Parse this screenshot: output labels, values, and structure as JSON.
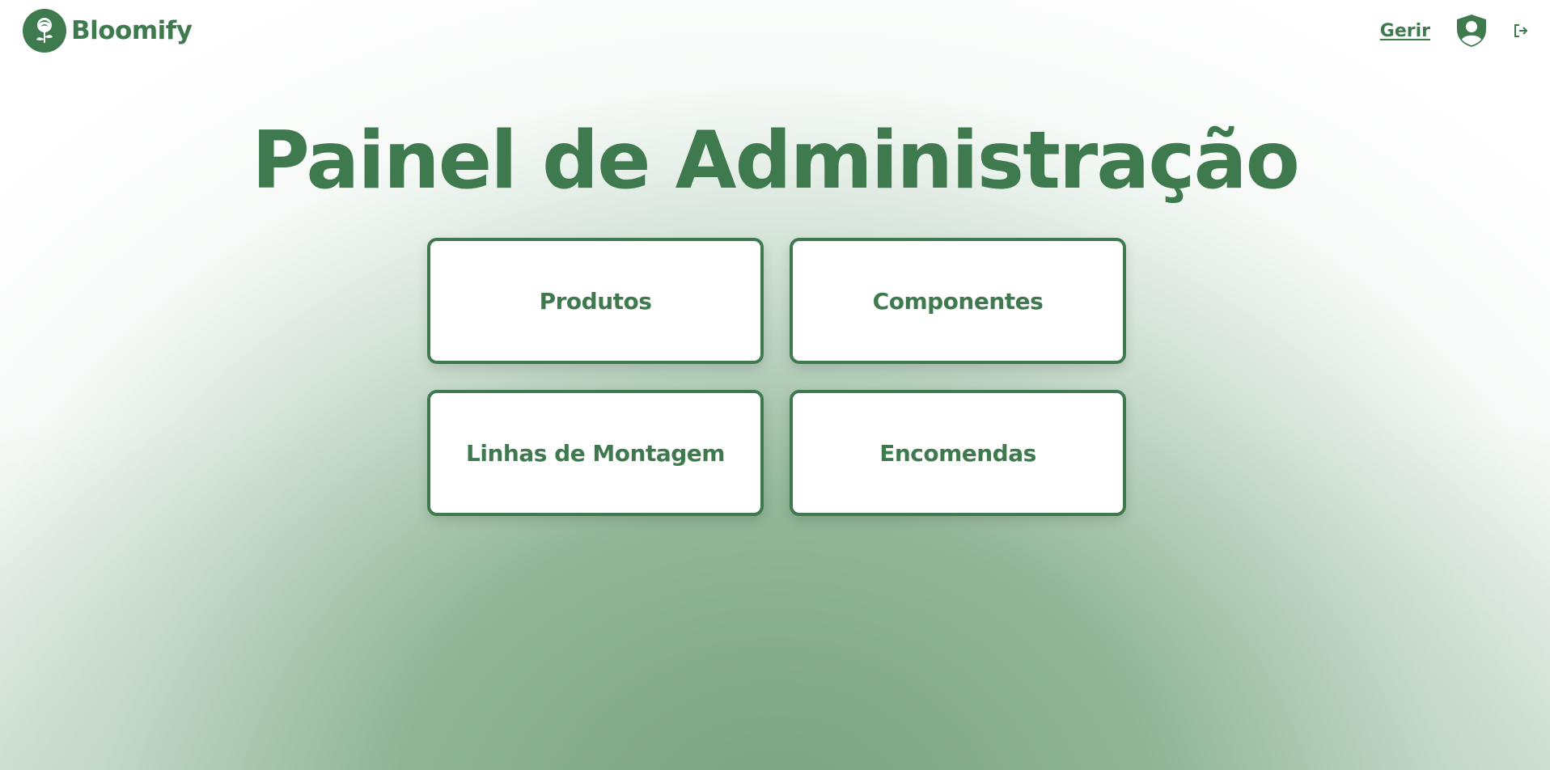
{
  "brand": {
    "name": "Bloomify",
    "logo_icon": "rose-icon"
  },
  "nav": {
    "manage_label": "Gerir",
    "profile_icon": "user-shield-icon",
    "logout_icon": "logout-icon"
  },
  "page": {
    "title": "Painel de Administração"
  },
  "cards": [
    {
      "label": "Produtos"
    },
    {
      "label": "Componentes"
    },
    {
      "label": "Linhas de Montagem"
    },
    {
      "label": "Encomendas"
    }
  ],
  "colors": {
    "primary": "#3f7a4f",
    "background_gradient_bottom": "#7aa282",
    "card_background": "#ffffff"
  }
}
